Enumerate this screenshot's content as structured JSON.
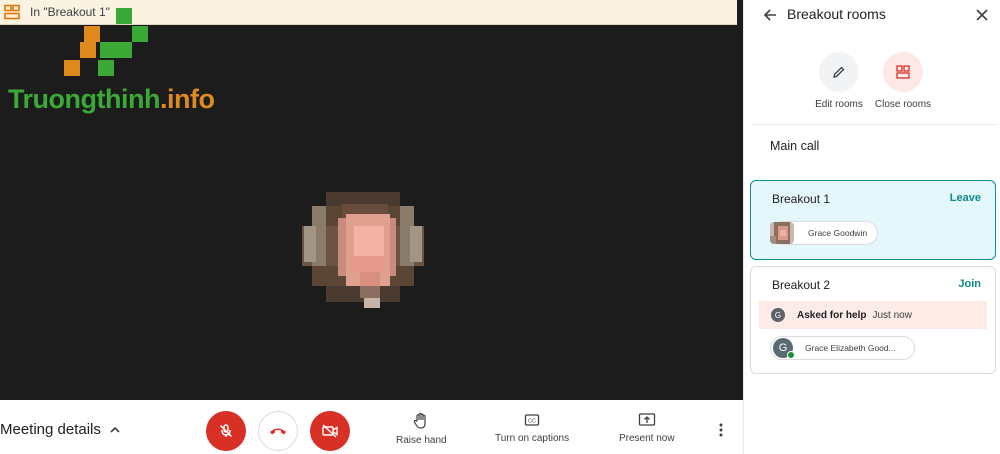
{
  "banner": {
    "text": "In \"Breakout 1\""
  },
  "watermark": {
    "text_main": "Truongthinh",
    "text_suffix": ".info"
  },
  "bottombar": {
    "meeting_details": "Meeting details",
    "raise_hand": "Raise hand",
    "captions": "Turn on captions",
    "present": "Present now"
  },
  "panel": {
    "title": "Breakout rooms",
    "edit_rooms": "Edit rooms",
    "close_rooms": "Close rooms",
    "main_call": "Main call",
    "rooms": [
      {
        "name": "Breakout 1",
        "action": "Leave",
        "participants": [
          "Grace Goodwin"
        ]
      },
      {
        "name": "Breakout 2",
        "action": "Join",
        "help": {
          "avatar": "G",
          "label": "Asked for help",
          "time": "Just now"
        },
        "participants": [
          "Grace Elizabeth Good..."
        ],
        "participant_avatar": "G"
      }
    ]
  },
  "colors": {
    "accent": "#0b8a8a",
    "danger": "#d93025",
    "help_bg": "#fcebe6",
    "active_room_bg": "#e4f7fb"
  }
}
